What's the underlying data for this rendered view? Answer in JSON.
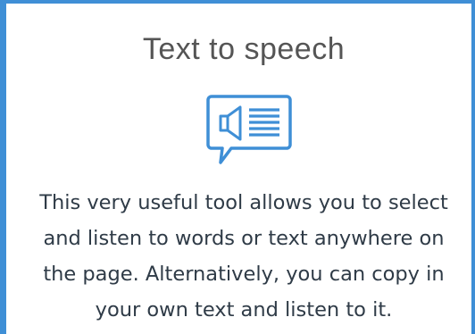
{
  "card": {
    "title": "Text to speech",
    "icon": "speech-bubble-speaker-text-icon",
    "description": "This very useful tool allows you to select and listen to words or text anywhere on the page. Alternatively, you can copy in your own text and listen to it.",
    "colors": {
      "accent": "#3f8fd6",
      "title": "#555555",
      "body_text": "#2f3b47",
      "background": "#ffffff"
    }
  }
}
